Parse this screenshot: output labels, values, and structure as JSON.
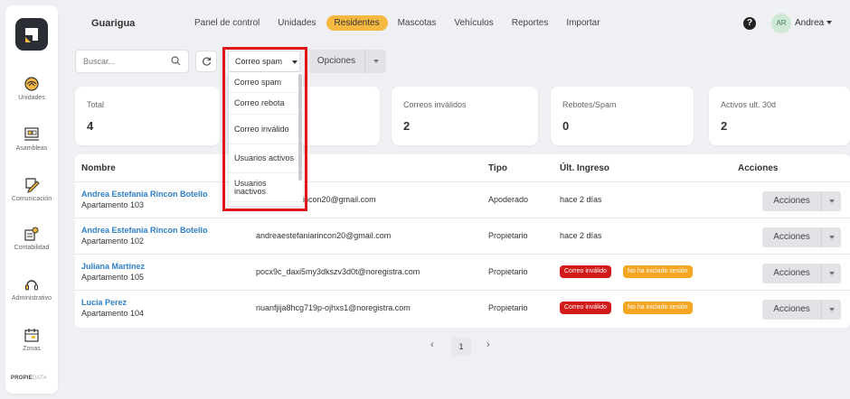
{
  "brand": {
    "logo": "propiedata-logo",
    "footer_name": "PROPIE",
    "footer_suffix": "DATA"
  },
  "sidebar": {
    "items": [
      {
        "label": "Unidades",
        "icon": "units-icon"
      },
      {
        "label": "Asambleas",
        "icon": "assembly-icon"
      },
      {
        "label": "Comunicación",
        "icon": "communication-icon"
      },
      {
        "label": "Contabilidad",
        "icon": "accounting-icon"
      },
      {
        "label": "Administrativo",
        "icon": "admin-icon"
      },
      {
        "label": "Zonas",
        "icon": "zones-icon"
      }
    ]
  },
  "header": {
    "org": "Guarigua",
    "nav": [
      "Panel de control",
      "Unidades",
      "Residentes",
      "Mascotas",
      "Vehículos",
      "Reportes",
      "Importar"
    ],
    "active_nav": "Residentes",
    "user_initials": "AR",
    "user_name": "Andrea"
  },
  "toolbar": {
    "search_placeholder": "Buscar...",
    "filter_selected": "Correo spam",
    "options_label": "Opciones"
  },
  "dropdown": {
    "options": [
      "Correo spam",
      "Correo rebota",
      "Correo inválido",
      "Usuarios activos",
      "Usuarios inactivos"
    ]
  },
  "stats": [
    {
      "title": "Total",
      "value": "4"
    },
    {
      "title": "",
      "value": ""
    },
    {
      "title": "Correos inválidos",
      "value": "2"
    },
    {
      "title": "Rebotes/Spam",
      "value": "0"
    },
    {
      "title": "Activos ult. 30d",
      "value": "2"
    }
  ],
  "table": {
    "headers": [
      "Nombre",
      "Tipo",
      "Últ. Ingreso",
      "Acciones"
    ],
    "rows": [
      {
        "name": "Andrea Estefania Rincon Botello",
        "unit": "Apartamento 103",
        "email": "rincon20@gmail.com",
        "email_full": "andreaestefaniarincon20@gmail.com",
        "type": "Apoderado",
        "last_login": "hace 2 días",
        "badges": []
      },
      {
        "name": "Andrea Estefania Rincon Botello",
        "unit": "Apartamento 102",
        "email": "andreaestefaniarincon20@gmail.com",
        "type": "Propietario",
        "last_login": "hace 2 días",
        "badges": []
      },
      {
        "name": "Juliana Martinez",
        "unit": "Apartamento 105",
        "email": "pocx9c_daxi5my3dkszv3d0t@noregistra.com",
        "type": "Propietario",
        "last_login": "",
        "badges": [
          "Correo inválido",
          "No ha iniciado sesión"
        ]
      },
      {
        "name": "Lucia Perez",
        "unit": "Apartamento 104",
        "email": "nuanfjija8hcg719p-ojhxs1@noregistra.com",
        "type": "Propietario",
        "last_login": "",
        "badges": [
          "Correo inválido",
          "No ha iniciado sesión"
        ]
      }
    ],
    "actions_label": "Acciones"
  },
  "pagination": {
    "prev": "‹",
    "current": "1",
    "next": "›"
  },
  "colors": {
    "accent": "#f5b841",
    "link": "#2f80c7",
    "danger": "#d11a1a",
    "warning": "#f5a623",
    "highlight": "#e0161a"
  }
}
